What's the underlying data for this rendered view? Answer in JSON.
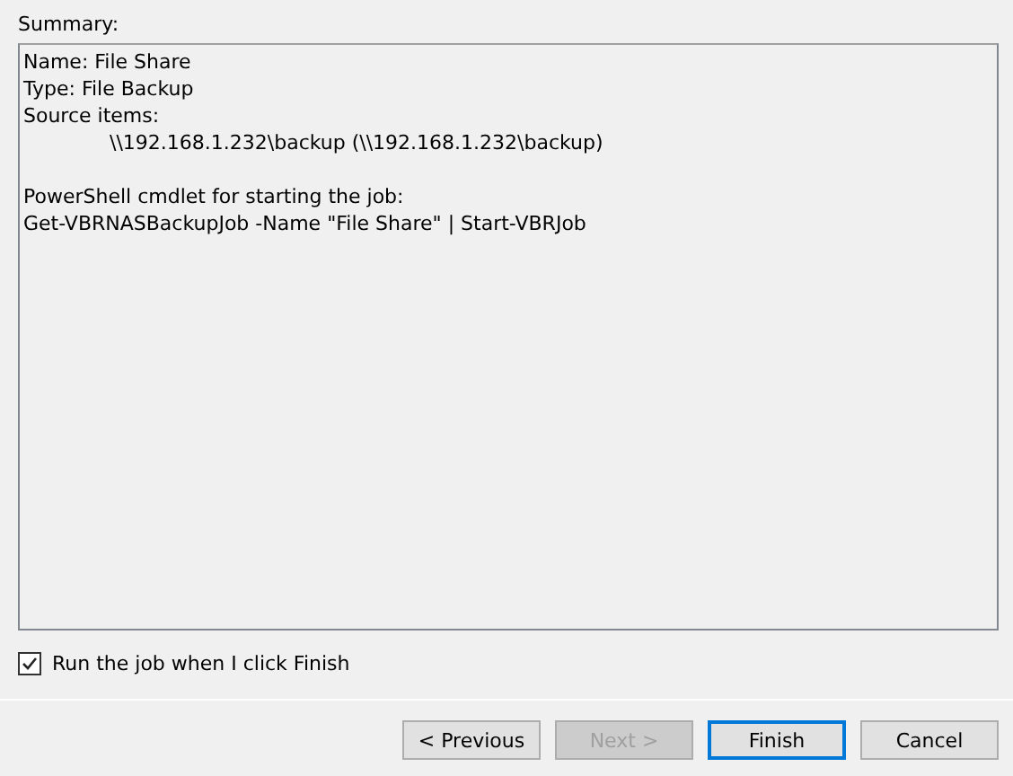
{
  "summary": {
    "label": "Summary:",
    "blocks": [
      [
        {
          "text": "Name: File Share",
          "kind": "plain"
        },
        {
          "text": "Type: File Backup",
          "kind": "plain"
        },
        {
          "text": "Source items:",
          "kind": "plain"
        },
        {
          "text": "\\\\192.168.1.232\\backup (\\\\192.168.1.232\\backup)",
          "kind": "indented"
        }
      ],
      [
        {
          "text": "PowerShell cmdlet for starting the job:",
          "kind": "plain"
        },
        {
          "text": "Get-VBRNASBackupJob -Name \"File Share\" | Start-VBRJob",
          "kind": "plain"
        }
      ]
    ]
  },
  "run_checkbox": {
    "label": "Run the job when I click Finish",
    "checked": true
  },
  "buttons": [
    {
      "label": "< Previous",
      "disabled": false,
      "default": false
    },
    {
      "label": "Next >",
      "disabled": true,
      "default": false
    },
    {
      "label": "Finish",
      "disabled": false,
      "default": true
    },
    {
      "label": "Cancel",
      "disabled": false,
      "default": false
    }
  ]
}
